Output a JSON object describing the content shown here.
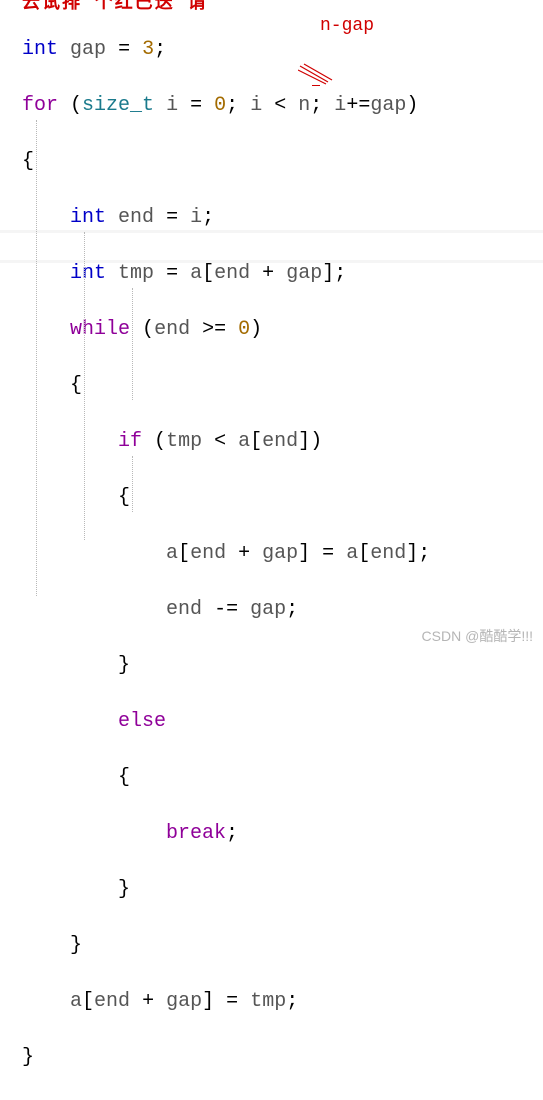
{
  "annotations": {
    "top_cropped": "云试排  个红巴迭  谓",
    "ngap": "n-gap"
  },
  "code": {
    "l1": {
      "kw": "int",
      "id": "gap",
      "op": "=",
      "val": "3",
      "semi": ";"
    },
    "l2": {
      "ctl": "for",
      "lp": "(",
      "type": "size_t",
      "id": "i",
      "op": "=",
      "val": "0",
      "semi1": ";",
      "id2": "i",
      "lt": "<",
      "n": "n",
      "semi2": ";",
      "id3": "i",
      "pe": "+=",
      "id4": "gap",
      "rp": ")"
    },
    "l3": {
      "brace": "{"
    },
    "l4": {
      "kw": "int",
      "id": "end",
      "op": "=",
      "rhs": "i",
      "semi": ";"
    },
    "l5": {
      "kw": "int",
      "id": "tmp",
      "op": "=",
      "arr": "a",
      "lb": "[",
      "e": "end",
      "plus": "+",
      "g": "gap",
      "rb": "]",
      "semi": ";"
    },
    "l6": {
      "ctl": "while",
      "lp": "(",
      "e": "end",
      "ge": ">=",
      "z": "0",
      "rp": ")"
    },
    "l7": {
      "brace": "{"
    },
    "l8": {
      "ctl": "if",
      "lp": "(",
      "t": "tmp",
      "lt": "<",
      "a": "a",
      "lb": "[",
      "e": "end",
      "rb": "]",
      "rp": ")"
    },
    "l9": {
      "brace": "{"
    },
    "l10": {
      "a": "a",
      "lb": "[",
      "e": "end",
      "plus": "+",
      "g": "gap",
      "rb": "]",
      "eq": "=",
      "a2": "a",
      "lb2": "[",
      "e2": "end",
      "rb2": "]",
      "semi": ";"
    },
    "l11": {
      "e": "end",
      "me": "-=",
      "g": "gap",
      "semi": ";"
    },
    "l12": {
      "brace": "}"
    },
    "l13": {
      "ctl": "else"
    },
    "l14": {
      "brace": "{"
    },
    "l15": {
      "ctl": "break",
      "semi": ";"
    },
    "l16": {
      "brace": "}"
    },
    "l17": {
      "brace": "}"
    },
    "l18": {
      "a": "a",
      "lb": "[",
      "e": "end",
      "plus": "+",
      "g": "gap",
      "rb": "]",
      "eq": "=",
      "t": "tmp",
      "semi": ";"
    },
    "l19": {
      "brace": "}"
    }
  },
  "watermark": "CSDN @酷酷学!!!"
}
